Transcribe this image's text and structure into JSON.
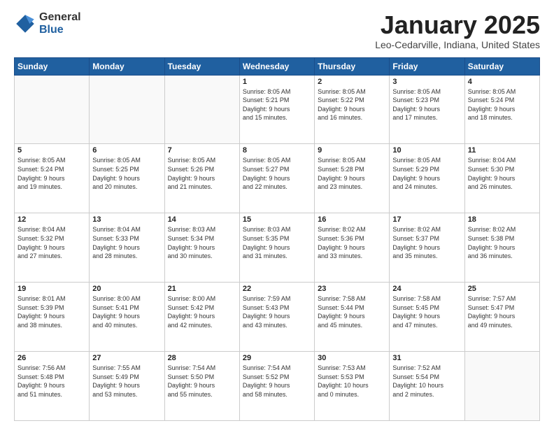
{
  "header": {
    "logo_general": "General",
    "logo_blue": "Blue",
    "month_title": "January 2025",
    "location": "Leo-Cedarville, Indiana, United States"
  },
  "days_of_week": [
    "Sunday",
    "Monday",
    "Tuesday",
    "Wednesday",
    "Thursday",
    "Friday",
    "Saturday"
  ],
  "weeks": [
    [
      {
        "day": "",
        "info": ""
      },
      {
        "day": "",
        "info": ""
      },
      {
        "day": "",
        "info": ""
      },
      {
        "day": "1",
        "info": "Sunrise: 8:05 AM\nSunset: 5:21 PM\nDaylight: 9 hours\nand 15 minutes."
      },
      {
        "day": "2",
        "info": "Sunrise: 8:05 AM\nSunset: 5:22 PM\nDaylight: 9 hours\nand 16 minutes."
      },
      {
        "day": "3",
        "info": "Sunrise: 8:05 AM\nSunset: 5:23 PM\nDaylight: 9 hours\nand 17 minutes."
      },
      {
        "day": "4",
        "info": "Sunrise: 8:05 AM\nSunset: 5:24 PM\nDaylight: 9 hours\nand 18 minutes."
      }
    ],
    [
      {
        "day": "5",
        "info": "Sunrise: 8:05 AM\nSunset: 5:24 PM\nDaylight: 9 hours\nand 19 minutes."
      },
      {
        "day": "6",
        "info": "Sunrise: 8:05 AM\nSunset: 5:25 PM\nDaylight: 9 hours\nand 20 minutes."
      },
      {
        "day": "7",
        "info": "Sunrise: 8:05 AM\nSunset: 5:26 PM\nDaylight: 9 hours\nand 21 minutes."
      },
      {
        "day": "8",
        "info": "Sunrise: 8:05 AM\nSunset: 5:27 PM\nDaylight: 9 hours\nand 22 minutes."
      },
      {
        "day": "9",
        "info": "Sunrise: 8:05 AM\nSunset: 5:28 PM\nDaylight: 9 hours\nand 23 minutes."
      },
      {
        "day": "10",
        "info": "Sunrise: 8:05 AM\nSunset: 5:29 PM\nDaylight: 9 hours\nand 24 minutes."
      },
      {
        "day": "11",
        "info": "Sunrise: 8:04 AM\nSunset: 5:30 PM\nDaylight: 9 hours\nand 26 minutes."
      }
    ],
    [
      {
        "day": "12",
        "info": "Sunrise: 8:04 AM\nSunset: 5:32 PM\nDaylight: 9 hours\nand 27 minutes."
      },
      {
        "day": "13",
        "info": "Sunrise: 8:04 AM\nSunset: 5:33 PM\nDaylight: 9 hours\nand 28 minutes."
      },
      {
        "day": "14",
        "info": "Sunrise: 8:03 AM\nSunset: 5:34 PM\nDaylight: 9 hours\nand 30 minutes."
      },
      {
        "day": "15",
        "info": "Sunrise: 8:03 AM\nSunset: 5:35 PM\nDaylight: 9 hours\nand 31 minutes."
      },
      {
        "day": "16",
        "info": "Sunrise: 8:02 AM\nSunset: 5:36 PM\nDaylight: 9 hours\nand 33 minutes."
      },
      {
        "day": "17",
        "info": "Sunrise: 8:02 AM\nSunset: 5:37 PM\nDaylight: 9 hours\nand 35 minutes."
      },
      {
        "day": "18",
        "info": "Sunrise: 8:02 AM\nSunset: 5:38 PM\nDaylight: 9 hours\nand 36 minutes."
      }
    ],
    [
      {
        "day": "19",
        "info": "Sunrise: 8:01 AM\nSunset: 5:39 PM\nDaylight: 9 hours\nand 38 minutes."
      },
      {
        "day": "20",
        "info": "Sunrise: 8:00 AM\nSunset: 5:41 PM\nDaylight: 9 hours\nand 40 minutes."
      },
      {
        "day": "21",
        "info": "Sunrise: 8:00 AM\nSunset: 5:42 PM\nDaylight: 9 hours\nand 42 minutes."
      },
      {
        "day": "22",
        "info": "Sunrise: 7:59 AM\nSunset: 5:43 PM\nDaylight: 9 hours\nand 43 minutes."
      },
      {
        "day": "23",
        "info": "Sunrise: 7:58 AM\nSunset: 5:44 PM\nDaylight: 9 hours\nand 45 minutes."
      },
      {
        "day": "24",
        "info": "Sunrise: 7:58 AM\nSunset: 5:45 PM\nDaylight: 9 hours\nand 47 minutes."
      },
      {
        "day": "25",
        "info": "Sunrise: 7:57 AM\nSunset: 5:47 PM\nDaylight: 9 hours\nand 49 minutes."
      }
    ],
    [
      {
        "day": "26",
        "info": "Sunrise: 7:56 AM\nSunset: 5:48 PM\nDaylight: 9 hours\nand 51 minutes."
      },
      {
        "day": "27",
        "info": "Sunrise: 7:55 AM\nSunset: 5:49 PM\nDaylight: 9 hours\nand 53 minutes."
      },
      {
        "day": "28",
        "info": "Sunrise: 7:54 AM\nSunset: 5:50 PM\nDaylight: 9 hours\nand 55 minutes."
      },
      {
        "day": "29",
        "info": "Sunrise: 7:54 AM\nSunset: 5:52 PM\nDaylight: 9 hours\nand 58 minutes."
      },
      {
        "day": "30",
        "info": "Sunrise: 7:53 AM\nSunset: 5:53 PM\nDaylight: 10 hours\nand 0 minutes."
      },
      {
        "day": "31",
        "info": "Sunrise: 7:52 AM\nSunset: 5:54 PM\nDaylight: 10 hours\nand 2 minutes."
      },
      {
        "day": "",
        "info": ""
      }
    ]
  ]
}
